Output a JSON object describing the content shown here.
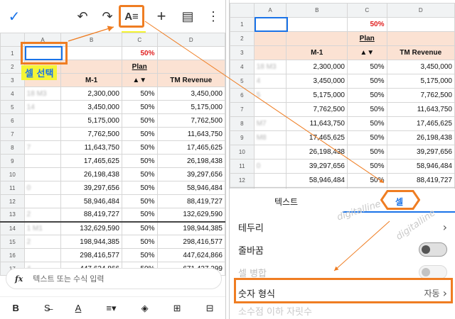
{
  "left": {
    "toolbar": {
      "check": "✓",
      "undo": "↶",
      "redo": "↷",
      "format": "A≡",
      "add": "+",
      "comment": "▤",
      "more": "⋮"
    },
    "label_format": "서식",
    "label_cell_select": "셀 선택",
    "col_headers": [
      "A",
      "B",
      "C",
      "D"
    ],
    "rows": [
      {
        "n": "1",
        "a": "",
        "b": "",
        "c": "50%",
        "d": ""
      },
      {
        "n": "2",
        "a": "",
        "b": "",
        "c": "Plan",
        "d": ""
      },
      {
        "n": "3",
        "a": "",
        "b": "M-1",
        "c": "▲▼",
        "d": "TM Revenue"
      },
      {
        "n": "4",
        "a": "18 M3",
        "b": "2,300,000",
        "c": "50%",
        "d": "3,450,000"
      },
      {
        "n": "5",
        "a": "14",
        "b": "3,450,000",
        "c": "50%",
        "d": "5,175,000"
      },
      {
        "n": "6",
        "a": "",
        "b": "5,175,000",
        "c": "50%",
        "d": "7,762,500"
      },
      {
        "n": "7",
        "a": "",
        "b": "7,762,500",
        "c": "50%",
        "d": "11,643,750"
      },
      {
        "n": "8",
        "a": "7",
        "b": "11,643,750",
        "c": "50%",
        "d": "17,465,625"
      },
      {
        "n": "9",
        "a": "",
        "b": "17,465,625",
        "c": "50%",
        "d": "26,198,438"
      },
      {
        "n": "10",
        "a": "",
        "b": "26,198,438",
        "c": "50%",
        "d": "39,297,656"
      },
      {
        "n": "11",
        "a": "0",
        "b": "39,297,656",
        "c": "50%",
        "d": "58,946,484"
      },
      {
        "n": "12",
        "a": "",
        "b": "58,946,484",
        "c": "50%",
        "d": "88,419,727"
      },
      {
        "n": "13",
        "a": "2",
        "b": "88,419,727",
        "c": "50%",
        "d": "132,629,590"
      },
      {
        "n": "14",
        "a": "1 M1",
        "b": "132,629,590",
        "c": "50%",
        "d": "198,944,385"
      },
      {
        "n": "15",
        "a": "2",
        "b": "198,944,385",
        "c": "50%",
        "d": "298,416,577"
      },
      {
        "n": "16",
        "a": "",
        "b": "298,416,577",
        "c": "50%",
        "d": "447,624,866"
      },
      {
        "n": "17",
        "a": "4",
        "b": "447,624,866",
        "c": "50%",
        "d": "671,437,299"
      }
    ],
    "fx_symbol": "fx",
    "fx_placeholder": "텍스트 또는 수식 입력",
    "bottom": {
      "bold": "B",
      "strike": "S̶",
      "color": "A",
      "align": "≡▾",
      "fill": "◈",
      "insert_row": "⊞",
      "insert_col": "⊟"
    },
    "watermark": "digitalline"
  },
  "right": {
    "col_headers": [
      "A",
      "B",
      "C",
      "D"
    ],
    "rows": [
      {
        "n": "1",
        "a": "",
        "b": "",
        "c": "50%",
        "d": ""
      },
      {
        "n": "2",
        "a": "",
        "b": "",
        "c": "Plan",
        "d": ""
      },
      {
        "n": "3",
        "a": "",
        "b": "M-1",
        "c": "▲▼",
        "d": "TM Revenue"
      },
      {
        "n": "4",
        "a": "18 M3",
        "b": "2,300,000",
        "c": "50%",
        "d": "3,450,000"
      },
      {
        "n": "5",
        "a": "4",
        "b": "3,450,000",
        "c": "50%",
        "d": "5,175,000"
      },
      {
        "n": "6",
        "a": "5",
        "b": "5,175,000",
        "c": "50%",
        "d": "7,762,500"
      },
      {
        "n": "7",
        "a": "",
        "b": "7,762,500",
        "c": "50%",
        "d": "11,643,750"
      },
      {
        "n": "8",
        "a": "M7",
        "b": "11,643,750",
        "c": "50%",
        "d": "17,465,625"
      },
      {
        "n": "9",
        "a": "M8",
        "b": "17,465,625",
        "c": "50%",
        "d": "26,198,438"
      },
      {
        "n": "10",
        "a": "",
        "b": "26,198,438",
        "c": "50%",
        "d": "39,297,656"
      },
      {
        "n": "11",
        "a": "0",
        "b": "39,297,656",
        "c": "50%",
        "d": "58,946,484"
      },
      {
        "n": "12",
        "a": "",
        "b": "58,946,484",
        "c": "50%",
        "d": "88,419,727"
      },
      {
        "n": "13",
        "a": "2",
        "b": "88,419,727",
        "c": "50%",
        "d": "132,629,590"
      }
    ],
    "tabs": {
      "text": "텍스트",
      "cell": "셀"
    },
    "menu": {
      "border": "테두리",
      "wrap": "줄바꿈",
      "merge": "셀 병합",
      "number_format": "숫자 형식",
      "number_format_value": "자동",
      "min_decimal": "소수점 이하 자릿수",
      "chevron": "›"
    },
    "watermark": "digitalline"
  },
  "colors": {
    "accent_orange": "#ef7d22",
    "select_blue": "#1a73e8",
    "label_yellow": "#f5f534",
    "header_peach": "#fbe2d3",
    "red_text": "#e02020"
  }
}
